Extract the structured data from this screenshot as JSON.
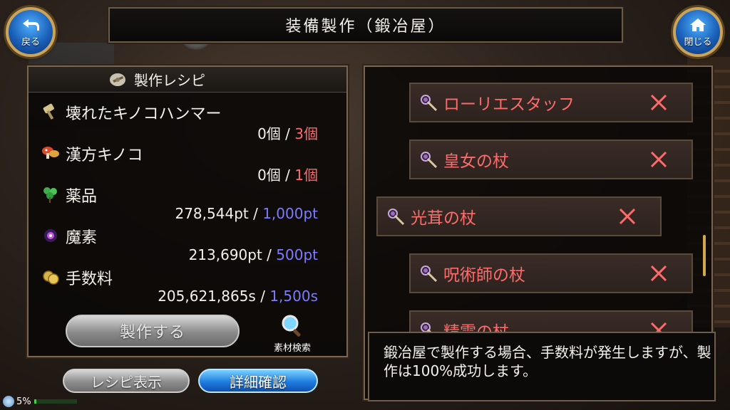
{
  "header": {
    "back_label": "戻る",
    "close_label": "閉じる",
    "title": "装備製作（鍛冶屋）"
  },
  "recipe": {
    "title": "製作レシピ",
    "materials": [
      {
        "name": "壊れたキノコハンマー",
        "have": "0個",
        "sep": "/",
        "need": "3個",
        "need_color": "red"
      },
      {
        "name": "漢方キノコ",
        "have": "0個",
        "sep": "/",
        "need": "1個",
        "need_color": "red"
      },
      {
        "name": "薬品",
        "have": "278,544pt",
        "sep": "/",
        "need": "1,000pt",
        "need_color": "blue"
      },
      {
        "name": "魔素",
        "have": "213,690pt",
        "sep": "/",
        "need": "500pt",
        "need_color": "blue"
      },
      {
        "name": "手数料",
        "have": "205,621,865s",
        "sep": "/",
        "need": "1,500s",
        "need_color": "blue"
      }
    ],
    "craft_label": "製作する",
    "search_label": "素材検索"
  },
  "bottom": {
    "recipe_view_label": "レシピ表示",
    "detail_label": "詳細確認"
  },
  "list": {
    "items": [
      {
        "name": "ローリエスタッフ"
      },
      {
        "name": "皇女の杖"
      },
      {
        "name": "光茸の杖"
      },
      {
        "name": "呪術師の杖"
      },
      {
        "name": "精霊の杖"
      }
    ]
  },
  "info": {
    "text": "鍛冶屋で製作する場合、手数料が発生しますが、製作は100%成功します。"
  },
  "status": {
    "percent": "5%",
    "progress": 0.05
  },
  "colors": {
    "red": "#ff6b6b",
    "blue": "#7e7bff",
    "gold": "#caa45a"
  }
}
